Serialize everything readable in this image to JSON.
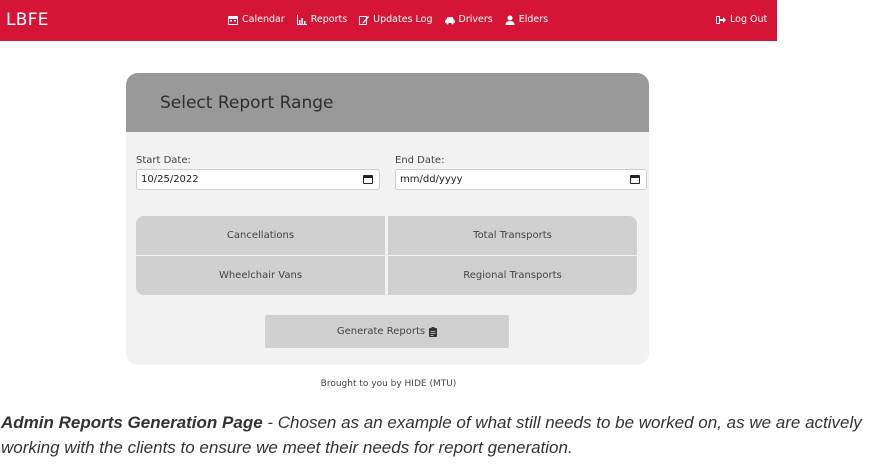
{
  "nav": {
    "brand": "LBFE",
    "items": [
      {
        "label": "Calendar",
        "icon": "calendar-icon"
      },
      {
        "label": "Reports",
        "icon": "chart-icon"
      },
      {
        "label": "Updates Log",
        "icon": "edit-icon"
      },
      {
        "label": "Drivers",
        "icon": "car-icon"
      },
      {
        "label": "Elders",
        "icon": "user-icon"
      }
    ],
    "logout": "Log Out"
  },
  "card": {
    "title": "Select Report Range",
    "start_label": "Start Date:",
    "start_value": "10/25/2022",
    "end_label": "End Date:",
    "end_value": "mm/dd/yyyy",
    "reports": [
      "Cancellations",
      "Total Transports",
      "Wheelchair Vans",
      "Regional Transports"
    ],
    "generate_label": "Generate Reports"
  },
  "footer": "Brought to you by HIDE (MTU)",
  "caption": {
    "bold": "Admin Reports Generation Page",
    "text": " - Chosen as an example of what still needs to be worked on, as we are actively working with the clients to ensure we meet their needs for report generation."
  },
  "colors": {
    "brand": "#d51535",
    "header": "#999999",
    "card": "#f2f2f2",
    "button": "#d0d0d0"
  }
}
